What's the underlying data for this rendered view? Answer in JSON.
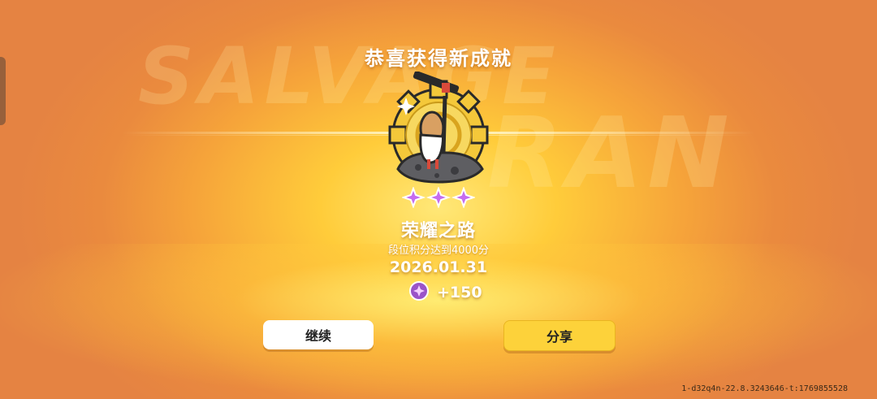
{
  "header": {
    "title": "恭喜获得新成就"
  },
  "background": {
    "watermark_line1": "SALVAGE",
    "watermark_line2": "RAN"
  },
  "achievement": {
    "stars": 3,
    "name": "荣耀之路",
    "description": "段位积分达到4000分",
    "date": "2026.01.31",
    "reward_value": "+150",
    "badge_icon": "shovel-character-badge-icon",
    "reward_icon": "gem-currency-icon"
  },
  "buttons": {
    "continue_label": "继续",
    "share_label": "分享"
  },
  "footer": {
    "id_text": "1-d32q4n-22.8.3243646-t:1769855528"
  },
  "colors": {
    "share_button": "#fdd23a",
    "continue_button": "#ffffff",
    "star_purple": "#c66cf0"
  }
}
